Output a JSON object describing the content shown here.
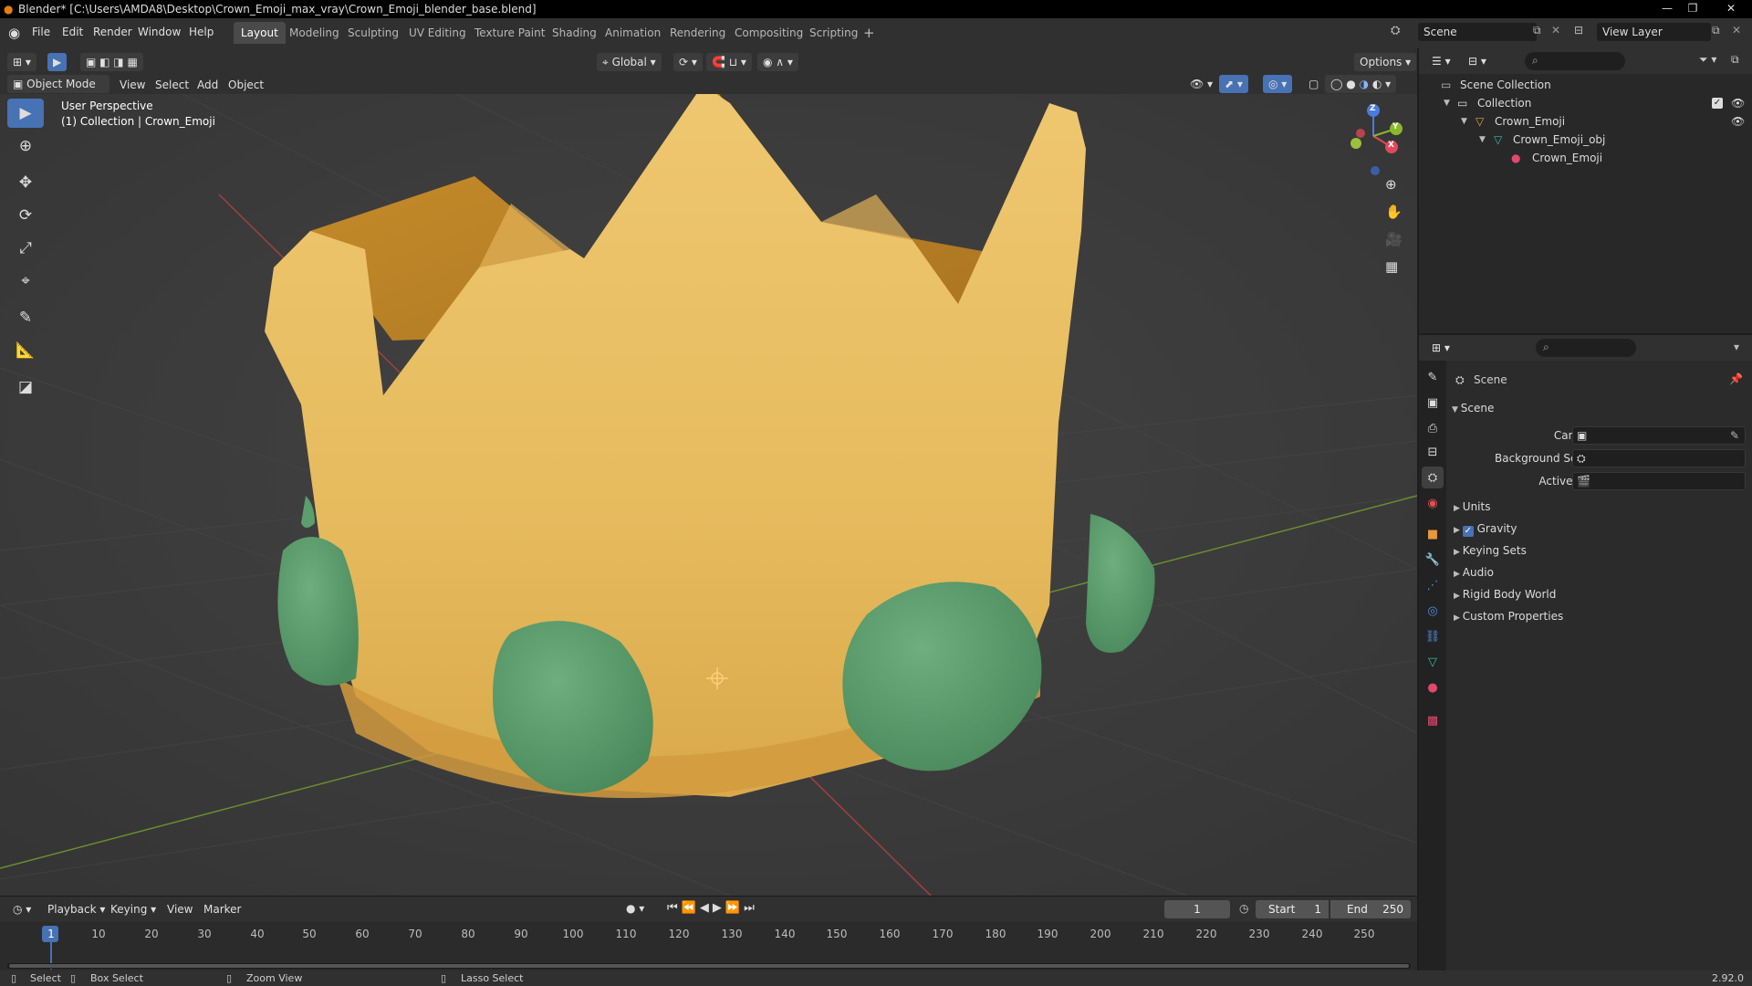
{
  "window": {
    "title": "Blender* [C:\\Users\\AMDA8\\Desktop\\Crown_Emoji_max_vray\\Crown_Emoji_blender_base.blend]"
  },
  "menus": [
    "File",
    "Edit",
    "Render",
    "Window",
    "Help"
  ],
  "workspaces": [
    "Layout",
    "Modeling",
    "Sculpting",
    "UV Editing",
    "Texture Paint",
    "Shading",
    "Animation",
    "Rendering",
    "Compositing",
    "Scripting"
  ],
  "active_workspace": "Layout",
  "scene_selector": "Scene",
  "view_layer_selector": "View Layer",
  "viewport": {
    "transform_orientation": "Global",
    "options_label": "Options",
    "mode": "Object Mode",
    "header_menus": [
      "View",
      "Select",
      "Add",
      "Object"
    ],
    "overlay_line1": "User Perspective",
    "overlay_line2": "(1) Collection | Crown_Emoji",
    "gizmo_axes": {
      "x": "X",
      "y": "Y",
      "z": "Z"
    },
    "colors": {
      "crown": "#e8bd62",
      "gem": "#5c9e6e",
      "background": "#3c3c3c",
      "x_axis": "#a04040",
      "y_axis": "#6b8f2e"
    }
  },
  "timeline": {
    "menus": [
      "Playback",
      "Keying",
      "View",
      "Marker"
    ],
    "current_frame": "1",
    "start_label": "Start",
    "start_value": "1",
    "end_label": "End",
    "end_value": "250",
    "ticks": [
      "1",
      "10",
      "20",
      "30",
      "40",
      "50",
      "60",
      "70",
      "80",
      "90",
      "100",
      "110",
      "120",
      "130",
      "140",
      "150",
      "160",
      "170",
      "180",
      "190",
      "200",
      "210",
      "220",
      "230",
      "240",
      "250"
    ]
  },
  "statusbar": {
    "select": "Select",
    "box_select": "Box Select",
    "zoom_view": "Zoom View",
    "lasso_select": "Lasso Select",
    "version": "2.92.0"
  },
  "outliner": {
    "rows": [
      {
        "label": "Scene Collection"
      },
      {
        "label": "Collection"
      },
      {
        "label": "Crown_Emoji"
      },
      {
        "label": "Crown_Emoji_obj"
      },
      {
        "label": "Crown_Emoji"
      }
    ]
  },
  "properties": {
    "context": "Scene",
    "panel_title": "Scene",
    "camera_label": "Camera",
    "background_scene_label": "Background Scene",
    "active_clip_label": "Active Clip",
    "subpanels": [
      "Units",
      "Gravity",
      "Keying Sets",
      "Audio",
      "Rigid Body World",
      "Custom Properties"
    ],
    "gravity_checked": true
  }
}
